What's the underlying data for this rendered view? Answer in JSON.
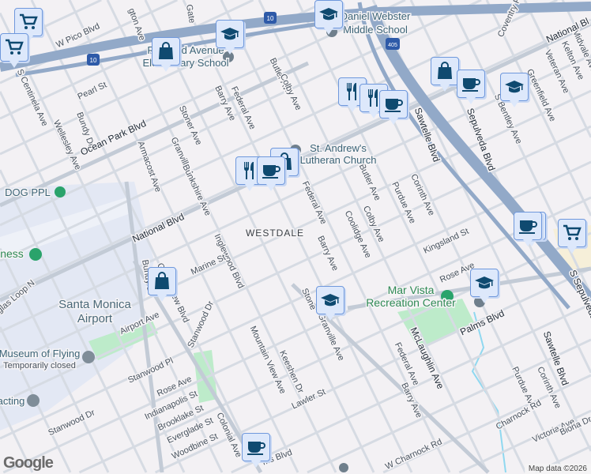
{
  "labels": [
    "W Pico Blvd",
    "gton Ave",
    "Gate",
    "Richland Avenue",
    "Elementary School",
    "Daniel Webster",
    "Middle School",
    "Pearl St",
    "S Centinela Ave",
    "Bundy Dr",
    "Wellesley Ave",
    "Ocean Park Blvd",
    "Armacost Ave",
    "Stoner Ave",
    "Granville Ave",
    "Barry Ave",
    "Federal Ave",
    "Butler Ave",
    "Colby Ave",
    "Bunkshire Ave",
    "DOG PPL",
    "National Blvd",
    "Inglewood Blvd",
    "Marine St",
    "WESTDALE",
    "Federal Ave",
    "Barry Ave",
    "Butler Ave",
    "Colby Ave",
    "Coolidge Ave",
    "Purdue Ave",
    "Corinth Ave",
    "St. Andrew's",
    "Lutheran Church",
    "Sawtelle Blvd",
    "Sepulveda Blvd",
    "S Sepulveda",
    "S Bentley Ave",
    "Greenfield Ave",
    "Veteran Ave",
    "Kelton Ave",
    "Midvale Ave",
    "National Bl",
    "Coventry Pl",
    "Kingsland St",
    "Rose Ave",
    "Mar Vista",
    "Recreation Center",
    "Palms Blvd",
    "McLaughlin Ave",
    "Stone",
    "Granville Ave",
    "Sawtelle Blvd",
    "Federal Ave",
    "Barry Ave",
    "Purdue Ave",
    "Corinth Ave",
    "Charnock Rd",
    "Victoria Ave",
    "Biona Dr",
    "W Charnock Rd",
    "Santa Monica",
    "Airport",
    "Airport Ave",
    "Museum of Flying",
    "Temporarily closed",
    "acting",
    "Stanwood Pl",
    "Rose Ave",
    "Indianapolis St",
    "Brooklake St",
    "Everglade St",
    "Woodbine St",
    "Stanwood Dr",
    "Stanwood Dr",
    "Mountain View Ave",
    "Keeshen Dr",
    "Lawler St",
    "Colonial Ave",
    "Grand View Blvd",
    "glas Loop N",
    "ness",
    "Bundy Dr",
    "ms Blvd"
  ],
  "shields": {
    "i10": "10",
    "i405": "405"
  },
  "markers": [
    {
      "type": "grocery"
    },
    {
      "type": "grocery"
    },
    {
      "type": "grocery"
    },
    {
      "type": "grocery"
    },
    {
      "type": "shopping"
    },
    {
      "type": "shopping"
    },
    {
      "type": "shopping"
    },
    {
      "type": "shopping"
    },
    {
      "type": "school"
    },
    {
      "type": "school"
    },
    {
      "type": "school"
    },
    {
      "type": "school"
    },
    {
      "type": "school"
    },
    {
      "type": "restaurant"
    },
    {
      "type": "restaurant"
    },
    {
      "type": "restaurant"
    },
    {
      "type": "cafe"
    },
    {
      "type": "cafe"
    },
    {
      "type": "cafe"
    },
    {
      "type": "cafe"
    },
    {
      "type": "cafe"
    }
  ],
  "logo": "Google",
  "attribution": "Map data ©2026",
  "colors": {
    "background": "#f3f1f4",
    "freeway": "#92a9c8",
    "park": "#bdebca",
    "airport": "#e3e8f4",
    "marker": "#0f4a70"
  }
}
